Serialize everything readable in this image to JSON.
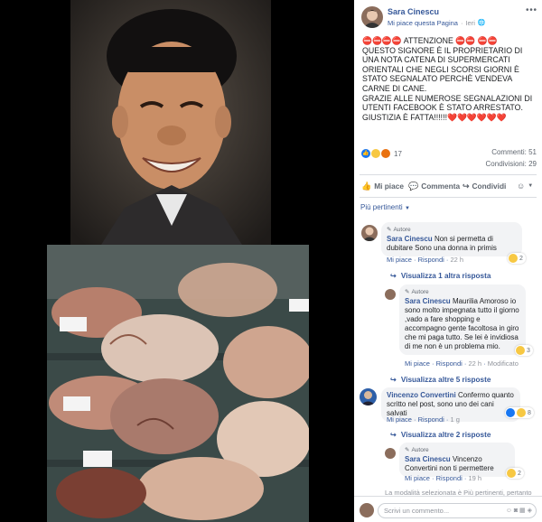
{
  "post": {
    "author": "Sara Cinescu",
    "liked_page": "Mi piace questa Pagina",
    "dot": "·",
    "time": "Ieri",
    "text_line1": "⛔⛔⛔⛔ ATTENZIONE ⛔⛔ ⛔⛔",
    "text_body": "QUESTO SIGNORE È IL PROPRIETARIO DI UNA NOTA CATENA DI SUPERMERCATI ORIENTALI CHE NEGLI SCORSI GIORNI È STATO SEGNALATO PERCHÈ VENDEVA CARNE DI CANE.",
    "text_body2": "GRAZIE ALLE NUMEROSE SEGNALAZIONI DI UTENTI FACEBOOK È STATO ARRESTATO.",
    "text_body3": "GIUSTIZIA È FATTA!!!!!!❤️❤️❤️❤️❤️❤️",
    "reaction_count": "17",
    "comments_count": "Commenti: 51",
    "shares_count": "Condivisioni: 29"
  },
  "actions": {
    "like": "Mi piace",
    "comment": "Commenta",
    "share": "Condividi"
  },
  "filter_label": "Più pertinenti",
  "comments": [
    {
      "badge": "Autore",
      "author": "Sara Cinescu",
      "text": "Non si permetta di dubitare Sono una donna in primis",
      "like": "Mi piace",
      "reply": "Rispondi",
      "time": "22 h",
      "reactions": "2",
      "more_replies": "Visualizza 1 altra risposta"
    },
    {
      "badge": "Autore",
      "author": "Sara Cinescu",
      "text": "Maurilia Amoroso io sono molto impegnata tutto il giorno ,vado a fare shopping e accompagno gente facoltosa in giro che mi paga tutto. Se lei è invidiosa di me non è un problema mio.",
      "like": "Mi piace",
      "reply": "Rispondi",
      "time": "22 h",
      "modified": "Modificato",
      "reactions": "3",
      "more_replies": "Visualizza altre 5 risposte"
    },
    {
      "author": "Vincenzo Convertini",
      "text": "Confermo quanto scritto nel post, sono uno dei cani salvati",
      "like": "Mi piace",
      "reply": "Rispondi",
      "time": "1 g",
      "reactions": "8",
      "more_replies": "Visualizza altre 2 risposte"
    },
    {
      "badge": "Autore",
      "author": "Sara Cinescu",
      "text": "Vincenzo Convertini non ti permettere",
      "like": "Mi piace",
      "reply": "Rispondi",
      "time": "19 h",
      "reactions": "2"
    }
  ],
  "footer_note": "La modalità selezionata è Più pertinenti, pertanto",
  "composer_placeholder": "Scrivi un commento...",
  "colors": {
    "link": "#365899",
    "bubble": "#f2f3f5",
    "heart": "#e0245e"
  }
}
